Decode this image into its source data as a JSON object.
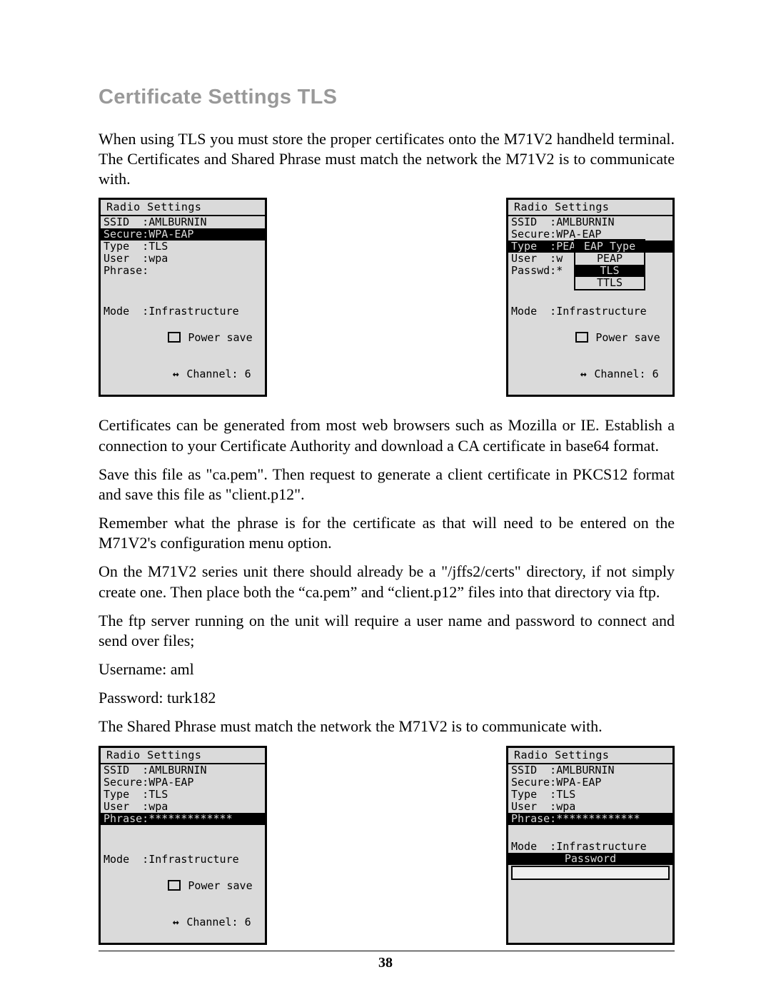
{
  "heading": "Certificate Settings TLS",
  "para1": "When using TLS you must store the proper certificates onto the M71V2 handheld terminal. The Certificates and Shared Phrase must match the network the M71V2 is to communicate with.",
  "para2": "Certificates can be generated from most web browsers such as Mozilla or IE. Establish a connection to your Certificate Authority and download a CA certificate in base64 format.",
  "para3": "Save this file as \"ca.pem\". Then request to generate a client certificate in PKCS12 format and save this file as \"client.p12\".",
  "para4": "Remember what the phrase is for the certificate as that will need to be entered on the M71V2's configuration menu option.",
  "para5": "On the M71V2 series unit there should already be a \"/jffs2/certs\" directory, if not simply create one. Then place both the “ca.pem” and “client.p12” files into that directory via ftp.",
  "para6": "The ftp server running on the unit will require a user name and password to connect and send over files;",
  "para7": "Username: aml",
  "para8": "Password: turk182",
  "para9": "The Shared Phrase must match the network the M71V2 is to communicate with.",
  "page_number": "38",
  "panel1": {
    "title": "Radio Settings",
    "ssid": "SSID  :AMLBURNIN",
    "secure": "Secure:WPA-EAP",
    "type": "Type  :TLS",
    "user": "User  :wpa",
    "phrase": "Phrase:",
    "mode": "Mode  :Infrastructure",
    "power": "Power save",
    "channel": "Channel: 6"
  },
  "panel2": {
    "title": "Radio Settings",
    "ssid": "SSID  :AMLBURNIN",
    "secure": "Secure:WPA-EAP",
    "type": "Type  :PEAP",
    "user": "User  :w",
    "passwd": "Passwd:*",
    "mode": "Mode  :Infrastructure",
    "power": "Power save",
    "channel": "Channel: 6",
    "popup": {
      "header": "EAP Type",
      "opt1": "PEAP",
      "opt2": "TLS",
      "opt3": "TTLS"
    }
  },
  "panel3": {
    "title": "Radio Settings",
    "ssid": "SSID  :AMLBURNIN",
    "secure": "Secure:WPA-EAP",
    "type": "Type  :TLS",
    "user": "User  :wpa",
    "phrase": "Phrase:*************",
    "mode": "Mode  :Infrastructure",
    "power": "Power save",
    "channel": "Channel: 6"
  },
  "panel4": {
    "title": "Radio Settings",
    "ssid": "SSID  :AMLBURNIN",
    "secure": "Secure:WPA-EAP",
    "type": "Type  :TLS",
    "user": "User  :wpa",
    "phrase": "Phrase:*************",
    "mode": "Mode  :Infrastructure",
    "pwlabel": "Password"
  }
}
